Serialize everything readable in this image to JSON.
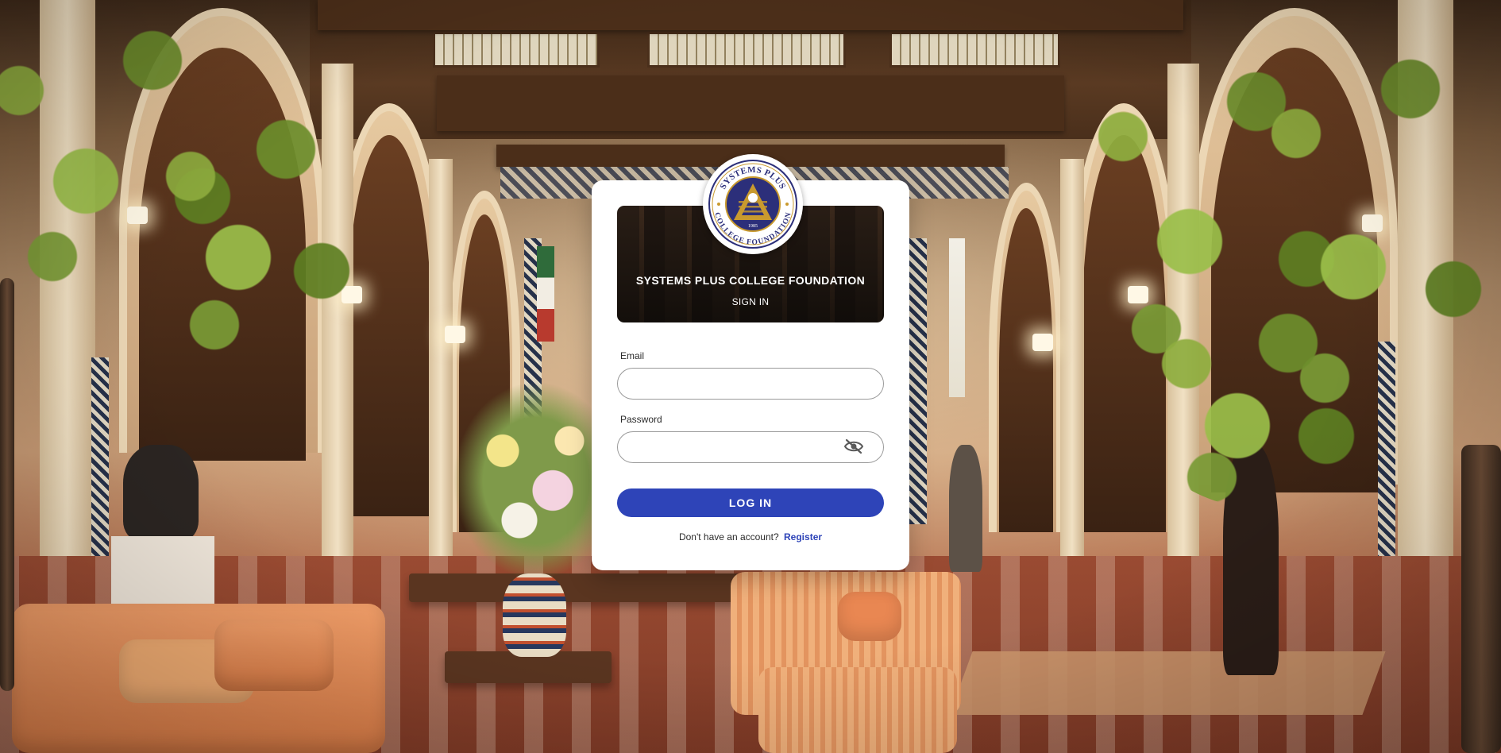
{
  "branding": {
    "college_name": "SYSTEMS PLUS COLLEGE FOUNDATION",
    "seal_top_text": "SYSTEMS PLUS",
    "seal_bottom_text": "COLLEGE FOUNDATION",
    "seal_year": "1985",
    "colors": {
      "seal_ring": "#ffffff",
      "seal_blue": "#2c2f7a",
      "seal_gold": "#c99a2e",
      "primary_button": "#2e44b8",
      "link": "#2e44b8"
    }
  },
  "banner": {
    "title": "SYSTEMS PLUS COLLEGE FOUNDATION",
    "subtitle": "SIGN IN"
  },
  "form": {
    "email_label": "Email",
    "email_value": "",
    "email_placeholder": "",
    "password_label": "Password",
    "password_value": "",
    "password_placeholder": "",
    "password_toggle_icon": "eye-off-icon",
    "login_label": "LOG IN"
  },
  "footer": {
    "prompt": "Don't have an account?",
    "register_label": "Register"
  }
}
